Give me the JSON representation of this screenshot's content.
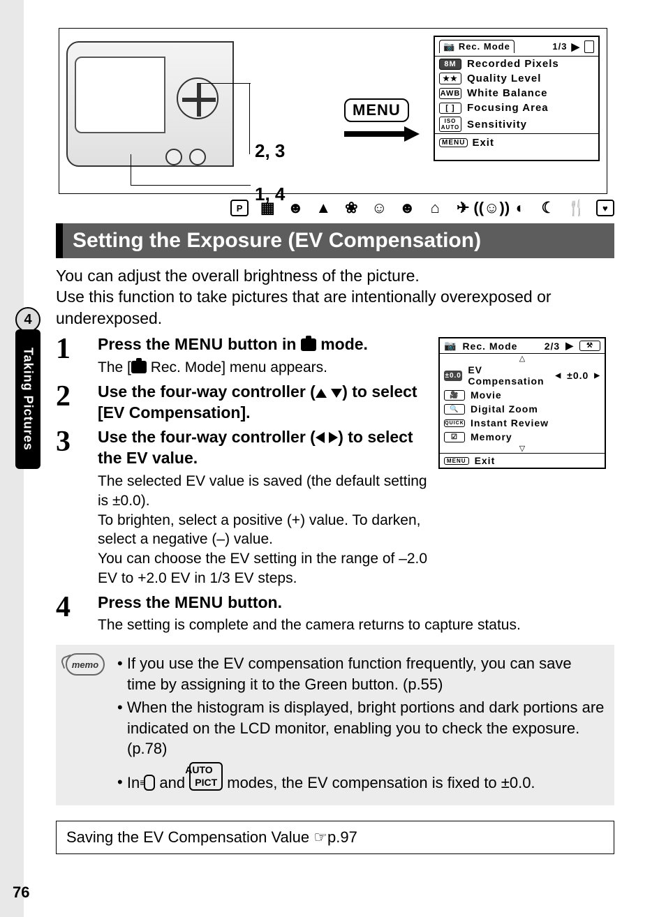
{
  "chapter": {
    "number": "4",
    "title": "Taking Pictures"
  },
  "illus": {
    "label_23": "2, 3",
    "label_14": "1, 4",
    "menu_chip": "MENU"
  },
  "osd1": {
    "title": "Rec. Mode",
    "page": "1/3",
    "rows": [
      {
        "icon": "8M",
        "label": "Recorded Pixels"
      },
      {
        "icon": "★★",
        "label": "Quality Level"
      },
      {
        "icon": "AWB",
        "label": "White Balance"
      },
      {
        "icon": "[ ]",
        "label": "Focusing Area"
      },
      {
        "icon": "ISO AUTO",
        "label": "Sensitivity"
      }
    ],
    "exit_menu": "MENU",
    "exit_label": "Exit"
  },
  "section_title": "Setting the Exposure (EV Compensation)",
  "intro": "You can adjust the overall brightness of the picture.\nUse this function to take pictures that are intentionally overexposed or underexposed.",
  "steps": {
    "s1": {
      "title_a": "Press the ",
      "title_menu": "MENU",
      "title_b": " button in ",
      "title_c": " mode.",
      "sub_a": "The [",
      "sub_b": " Rec. Mode] menu appears."
    },
    "s2": {
      "title_a": "Use the four-way controller (",
      "title_b": ") to select [EV Compensation]."
    },
    "s3": {
      "title_a": "Use the four-way controller (",
      "title_b": ") to select the EV value.",
      "sub": "The selected EV value is saved (the default setting is ±0.0).\nTo brighten, select a positive (+) value. To darken, select a negative (–) value.\nYou can choose the EV setting in the range of –2.0 EV to +2.0 EV in 1/3 EV steps."
    },
    "s4": {
      "title_a": "Press the ",
      "title_menu": "MENU",
      "title_b": " button.",
      "sub": "The setting is complete and the camera returns to capture status."
    }
  },
  "osd2": {
    "title": "Rec. Mode",
    "page": "2/3",
    "rows": [
      {
        "icon": "±0.0",
        "label": "EV Compensation",
        "value": "±0.0"
      },
      {
        "icon": "🎥",
        "label": "Movie"
      },
      {
        "icon": "🔍",
        "label": "Digital Zoom"
      },
      {
        "icon": "QUICK",
        "label": "Instant Review"
      },
      {
        "icon": "☑",
        "label": "Memory"
      }
    ],
    "exit_menu": "MENU",
    "exit_label": "Exit"
  },
  "memo": {
    "label": "memo",
    "items": [
      "If you use the EV compensation function frequently, you can save time by assigning it to the Green button. (p.55)",
      "When the histogram is displayed, bright portions and dark portions are indicated on the LCD monitor, enabling you to check the exposure. (p.78)"
    ],
    "item3_a": "In ",
    "item3_b": " and ",
    "item3_c": " modes, the EV compensation is fixed to ±0.0."
  },
  "ref": {
    "text": "Saving the EV Compensation Value ",
    "page": "p.97"
  },
  "page_number": "76"
}
